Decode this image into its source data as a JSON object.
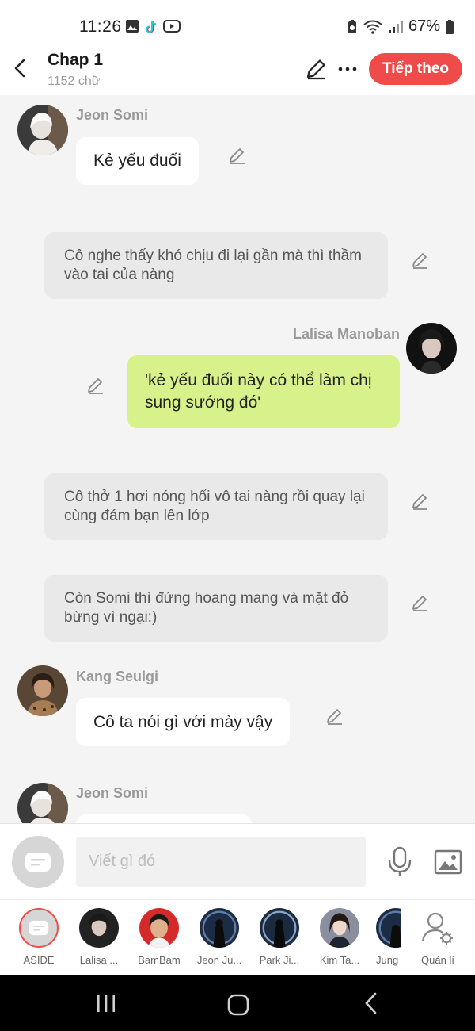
{
  "status_bar": {
    "time": "11:26",
    "battery": "67%",
    "icons_left": [
      "gallery-icon",
      "tiktok-icon",
      "youtube-icon"
    ],
    "icons_right": [
      "battery-saver-icon",
      "wifi-icon",
      "signal-icon",
      "battery-icon"
    ]
  },
  "header": {
    "title": "Chap 1",
    "subtitle": "1152 chữ",
    "next_label": "Tiếp theo",
    "accent": "#f04b4b"
  },
  "messages": [
    {
      "type": "left",
      "name": "Jeon Somi",
      "text": "Kẻ yếu đuối"
    },
    {
      "type": "narration",
      "text": "Cô nghe thấy khó chịu đi lại gần mà thì thầm vào tai của nàng"
    },
    {
      "type": "right",
      "name": "Lalisa Manoban",
      "text": "'kẻ yếu đuối này có thể làm chị sung sướng đó'"
    },
    {
      "type": "narration",
      "text": "Cô thở 1 hơi nóng hổi vô tai nàng rồi quay lại cùng đám bạn lên lớp"
    },
    {
      "type": "narration",
      "text": "Còn Somi thì đứng hoang mang và mặt đỏ bừng vì ngại:)"
    },
    {
      "type": "left",
      "name": "Kang Seulgi",
      "text": "Cô ta nói gì với mày vậy"
    },
    {
      "type": "left",
      "name": "Jeon Somi",
      "text": ""
    }
  ],
  "composer": {
    "placeholder": "Viết gì đó",
    "value": ""
  },
  "characters": [
    {
      "label": "ASIDE"
    },
    {
      "label": "Lalisa ..."
    },
    {
      "label": "BamBam"
    },
    {
      "label": "Jeon Ju..."
    },
    {
      "label": "Park Ji..."
    },
    {
      "label": "Kim Ta..."
    },
    {
      "label": "Jung"
    },
    {
      "label": "Quản lí"
    }
  ],
  "colors": {
    "right_bubble": "#d7f28a",
    "narration_bg": "#e9e9e9",
    "left_bubble": "#ffffff"
  }
}
